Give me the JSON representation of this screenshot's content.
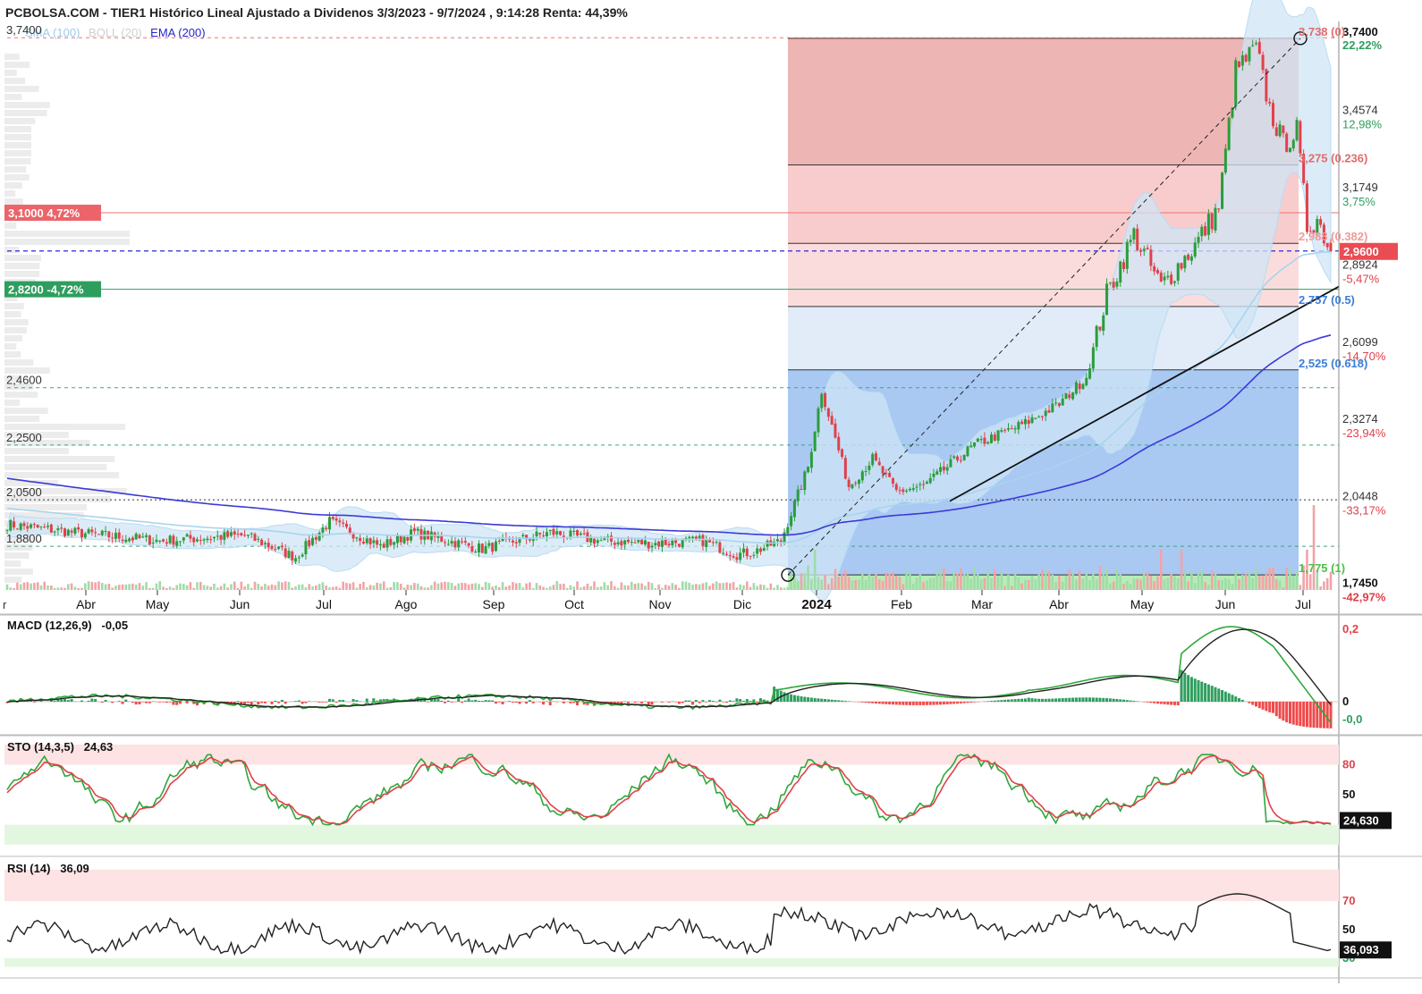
{
  "header": {
    "title": "PCBOLSA.COM - TIER1 Histórico Lineal Ajustado a Dividenos 3/3/2023 - 9/7/2024 , 9:14:28 Renta: 44,39%"
  },
  "legend": [
    {
      "label": "SMA (100)",
      "color": "#9ccbe8"
    },
    {
      "label": "BOLL (20)",
      "color": "#cfcfcf"
    },
    {
      "label": "EMA (200)",
      "color": "#2424c8"
    }
  ],
  "colors": {
    "up": "#2a9d3a",
    "down": "#e0414b",
    "ema": "#3a3ad8",
    "sma": "#a8d4ee",
    "boll_fill": "#cfe6f6",
    "fib_red": "#f4a9a9",
    "fib_blue": "#9cc0f0",
    "fib_green": "#b8ecb6"
  },
  "price_axis": {
    "left_labels": [
      "3,7400",
      "2,4600",
      "2,2500",
      "2,0500",
      "1,8800"
    ],
    "right_labels": [
      {
        "price": "3,4574",
        "pct": "12,98%"
      },
      {
        "price": "3,1749",
        "pct": "3,75%"
      },
      {
        "price": "2,8924",
        "pct": "-5,47%"
      },
      {
        "price": "2,6099",
        "pct": "-14,70%"
      },
      {
        "price": "2,3274",
        "pct": "-23,94%"
      },
      {
        "price": "2,0448",
        "pct": "-33,17%"
      }
    ],
    "top_box": {
      "price": "3,7400",
      "pct": "22,22%"
    },
    "low_box": {
      "price": "1,7450",
      "pct": "-42,97%"
    },
    "last_price": "2,9600",
    "upper_band": "3,1000  4,72%",
    "lower_band": "2,8200  -4,72%"
  },
  "fib_labels": [
    {
      "text": "3,738 (0)",
      "color": "#e36b6b"
    },
    {
      "text": "3,275 (0.236)",
      "color": "#e36b6b"
    },
    {
      "text": "2,988 (0.382)",
      "color": "#f09a9a"
    },
    {
      "text": "2,757 (0.5)",
      "color": "#3d7dd8"
    },
    {
      "text": "2,525 (0.618)",
      "color": "#3d7dd8"
    },
    {
      "text": "1,775 (1)",
      "color": "#4cbf4c"
    }
  ],
  "months": [
    "Abr",
    "May",
    "Jun",
    "Jul",
    "Ago",
    "Sep",
    "Oct",
    "Nov",
    "Dic",
    "2024",
    "Feb",
    "Mar",
    "Abr",
    "May",
    "Jun",
    "Jul"
  ],
  "month_edge": "r",
  "indicators": {
    "macd": {
      "label": "MACD (12,26,9)",
      "value": "-0,05",
      "axis": [
        "0,2",
        "0",
        "-0,0"
      ]
    },
    "sto": {
      "label": "STO (14,3,5)",
      "value": "24,63",
      "axis": [
        "80",
        "50",
        "20"
      ],
      "last": "24,630"
    },
    "rsi": {
      "label": "RSI (14)",
      "value": "36,09",
      "axis": [
        "70",
        "50",
        "30"
      ],
      "last": "36,093"
    }
  },
  "chart_data": {
    "type": "candlestick",
    "period": "3/3/2023 - 9/7/2024",
    "xlabel": "",
    "ylabel": "",
    "ylim": [
      1.72,
      3.78
    ],
    "close_anchors": [
      {
        "x": 0,
        "y": 1.96
      },
      {
        "x": 20,
        "y": 1.93
      },
      {
        "x": 45,
        "y": 1.9
      },
      {
        "x": 70,
        "y": 1.92
      },
      {
        "x": 85,
        "y": 1.84
      },
      {
        "x": 95,
        "y": 1.97
      },
      {
        "x": 110,
        "y": 1.88
      },
      {
        "x": 120,
        "y": 1.93
      },
      {
        "x": 140,
        "y": 1.87
      },
      {
        "x": 160,
        "y": 1.93
      },
      {
        "x": 175,
        "y": 1.9
      },
      {
        "x": 190,
        "y": 1.89
      },
      {
        "x": 205,
        "y": 1.9
      },
      {
        "x": 215,
        "y": 1.85
      },
      {
        "x": 220,
        "y": 1.86
      },
      {
        "x": 228,
        "y": 1.9
      },
      {
        "x": 236,
        "y": 2.17
      },
      {
        "x": 240,
        "y": 2.45
      },
      {
        "x": 248,
        "y": 2.1
      },
      {
        "x": 255,
        "y": 2.2
      },
      {
        "x": 262,
        "y": 2.08
      },
      {
        "x": 270,
        "y": 2.1
      },
      {
        "x": 285,
        "y": 2.25
      },
      {
        "x": 300,
        "y": 2.33
      },
      {
        "x": 310,
        "y": 2.4
      },
      {
        "x": 318,
        "y": 2.5
      },
      {
        "x": 324,
        "y": 2.8
      },
      {
        "x": 332,
        "y": 3.02
      },
      {
        "x": 340,
        "y": 2.83
      },
      {
        "x": 350,
        "y": 2.98
      },
      {
        "x": 357,
        "y": 3.12
      },
      {
        "x": 362,
        "y": 3.62
      },
      {
        "x": 368,
        "y": 3.7
      },
      {
        "x": 372,
        "y": 3.48
      },
      {
        "x": 376,
        "y": 3.35
      },
      {
        "x": 380,
        "y": 3.4
      },
      {
        "x": 383,
        "y": 3.05
      },
      {
        "x": 386,
        "y": 3.08
      },
      {
        "x": 390,
        "y": 2.96
      }
    ],
    "fib_levels": [
      {
        "ratio": 0,
        "price": 3.738
      },
      {
        "ratio": 0.236,
        "price": 3.275
      },
      {
        "ratio": 0.382,
        "price": 2.988
      },
      {
        "ratio": 0.5,
        "price": 2.757
      },
      {
        "ratio": 0.618,
        "price": 2.525
      },
      {
        "ratio": 1,
        "price": 1.775
      }
    ],
    "last_close": 2.96
  }
}
